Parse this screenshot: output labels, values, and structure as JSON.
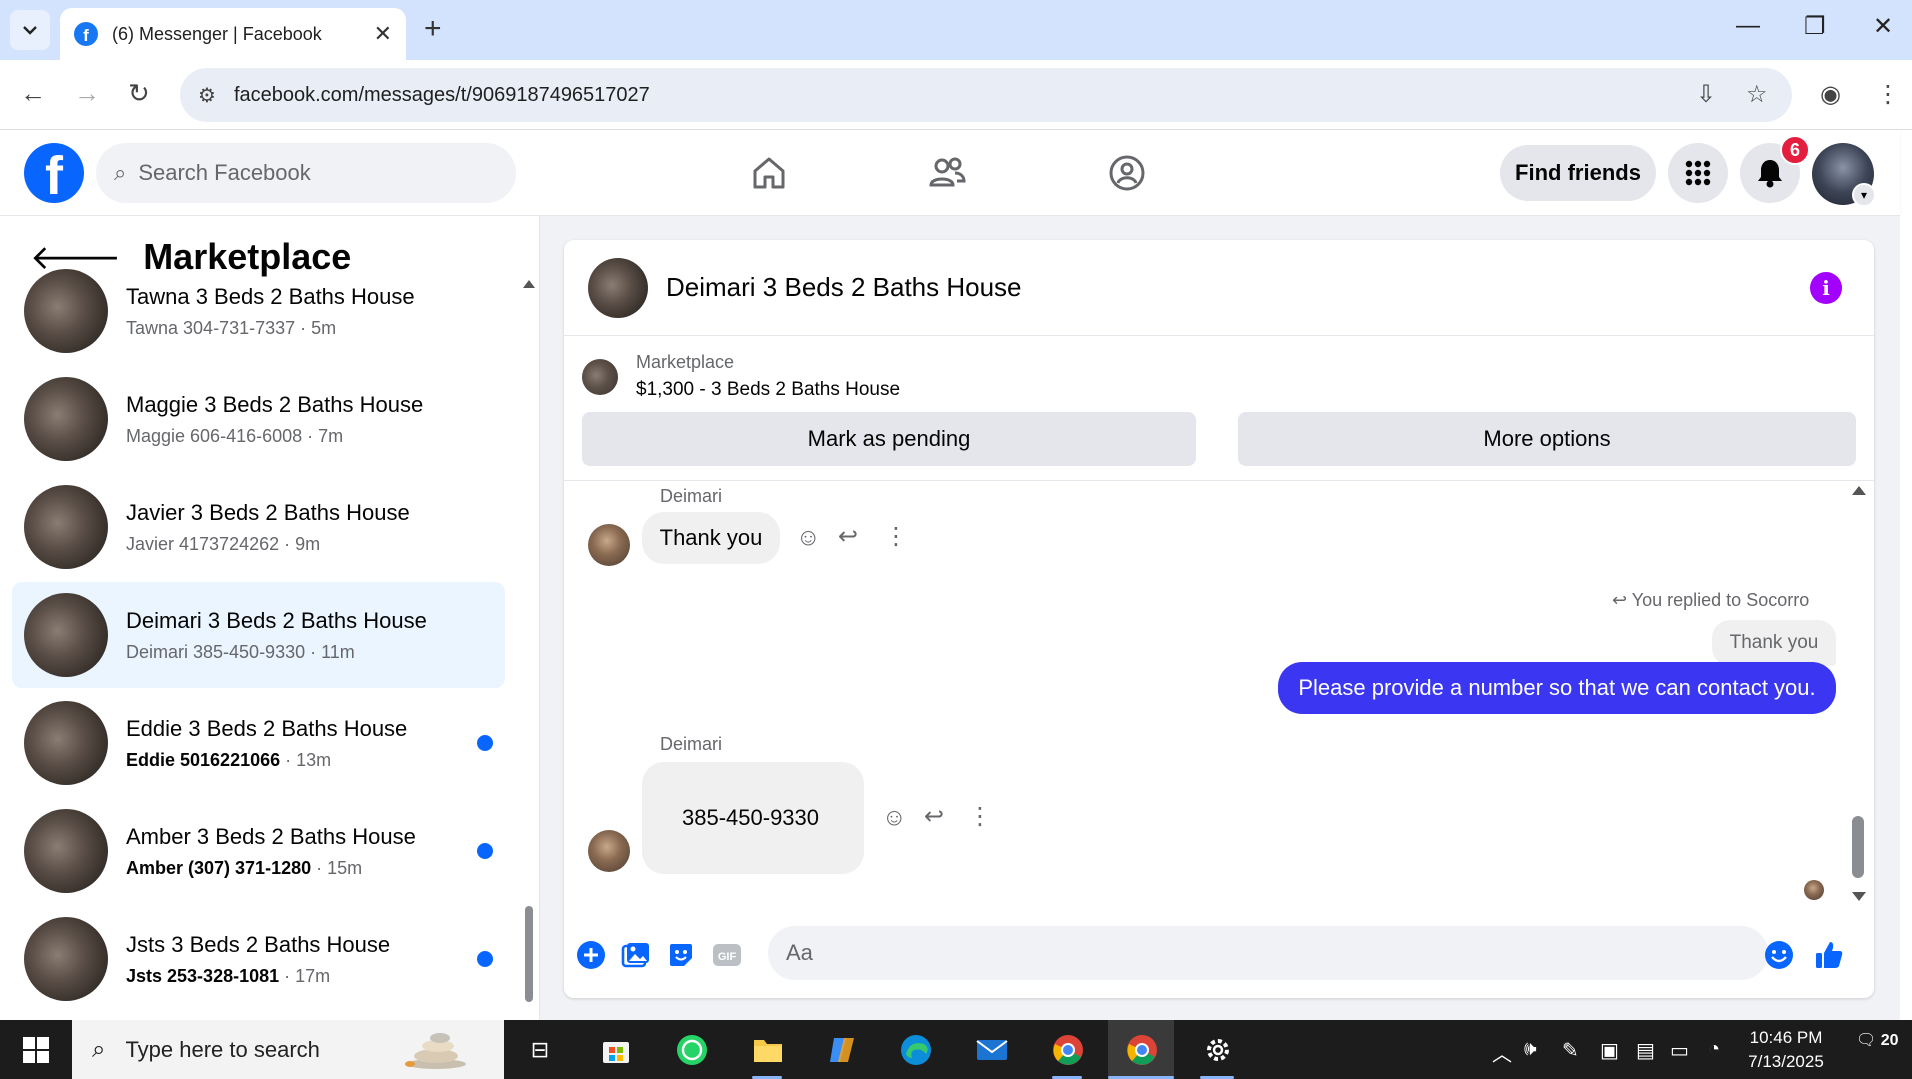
{
  "browser": {
    "tab_title": "(6) Messenger | Facebook",
    "url": "facebook.com/messages/t/9069187496517027"
  },
  "header": {
    "search_placeholder": "Search Facebook",
    "find_friends": "Find friends",
    "notification_count": "6"
  },
  "sidebar": {
    "title": "Marketplace",
    "conversations": [
      {
        "name": "Tawna 3 Beds 2 Baths House",
        "preview": "Tawna 304-731-7337",
        "time": "5m",
        "unread": false
      },
      {
        "name": "Maggie 3 Beds 2 Baths House",
        "preview": "Maggie 606-416-6008",
        "time": "7m",
        "unread": false
      },
      {
        "name": "Javier 3 Beds 2 Baths House",
        "preview": "Javier 4173724262",
        "time": "9m",
        "unread": false
      },
      {
        "name": "Deimari 3 Beds 2 Baths House",
        "preview": "Deimari 385-450-9330",
        "time": "11m",
        "unread": false,
        "active": true
      },
      {
        "name": "Eddie 3 Beds 2 Baths House",
        "preview": "Eddie 5016221066",
        "time": "13m",
        "unread": true
      },
      {
        "name": "Amber 3 Beds 2 Baths House",
        "preview": "Amber (307) 371-1280",
        "time": "15m",
        "unread": true
      },
      {
        "name": "Jsts 3 Beds 2 Baths House",
        "preview": "Jsts 253-328-1081",
        "time": "17m",
        "unread": true
      }
    ]
  },
  "chat": {
    "title": "Deimari 3 Beds 2 Baths House",
    "listing_label": "Marketplace",
    "listing_title": "$1,300 - 3 Beds 2 Baths House",
    "mark_pending": "Mark as pending",
    "more_options": "More options",
    "messages": {
      "sender1": "Deimari",
      "msg1": "Thank you",
      "replied_to": "You replied to Socorro",
      "quoted": "Thank you",
      "my_msg": "Please provide a number so that we can contact you.",
      "sender2": "Deimari",
      "msg2": "385-450-9330"
    },
    "composer_placeholder": "Aa"
  },
  "taskbar": {
    "search_placeholder": "Type here to search",
    "time": "10:46 PM",
    "date": "7/13/2025",
    "notifications": "20"
  },
  "colors": {
    "fb_blue": "#0866ff",
    "outgoing_bubble": "#3a36f1",
    "info": "#a200ff",
    "badge": "#e41e3f"
  }
}
